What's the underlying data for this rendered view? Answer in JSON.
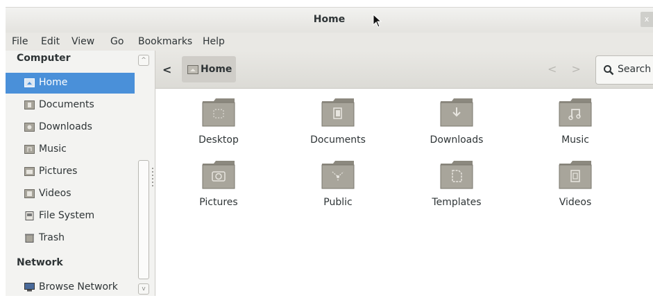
{
  "window": {
    "title": "Home",
    "close_label": "x"
  },
  "menu": [
    "File",
    "Edit",
    "View",
    "Go",
    "Bookmarks",
    "Help"
  ],
  "sidebar": {
    "computer_header": "Computer",
    "network_header": "Network",
    "items": [
      {
        "label": "Home",
        "icon": "home-folder-icon",
        "selected": true
      },
      {
        "label": "Documents",
        "icon": "documents-folder-icon"
      },
      {
        "label": "Downloads",
        "icon": "downloads-folder-icon"
      },
      {
        "label": "Music",
        "icon": "music-folder-icon"
      },
      {
        "label": "Pictures",
        "icon": "pictures-folder-icon"
      },
      {
        "label": "Videos",
        "icon": "videos-folder-icon"
      },
      {
        "label": "File System",
        "icon": "drive-icon"
      },
      {
        "label": "Trash",
        "icon": "trash-icon"
      }
    ],
    "network_items": [
      {
        "label": "Browse Network",
        "icon": "network-icon"
      }
    ],
    "scroll_up": "^",
    "scroll_down": "v"
  },
  "toolbar": {
    "back_label": "<",
    "crumb_label": "Home",
    "search_label": "Search",
    "nav_prev": "<",
    "nav_next": ">"
  },
  "folders": [
    {
      "label": "Desktop",
      "icon": "desktop-folder-icon"
    },
    {
      "label": "Documents",
      "icon": "documents-folder-icon"
    },
    {
      "label": "Downloads",
      "icon": "downloads-folder-icon"
    },
    {
      "label": "Music",
      "icon": "music-folder-icon"
    },
    {
      "label": "Pictures",
      "icon": "pictures-folder-icon"
    },
    {
      "label": "Public",
      "icon": "public-folder-icon"
    },
    {
      "label": "Templates",
      "icon": "templates-folder-icon"
    },
    {
      "label": "Videos",
      "icon": "videos-folder-icon"
    }
  ],
  "colors": {
    "selection": "#4a90d9",
    "folder": "#a8a59b",
    "folder_dark": "#8c897f"
  }
}
